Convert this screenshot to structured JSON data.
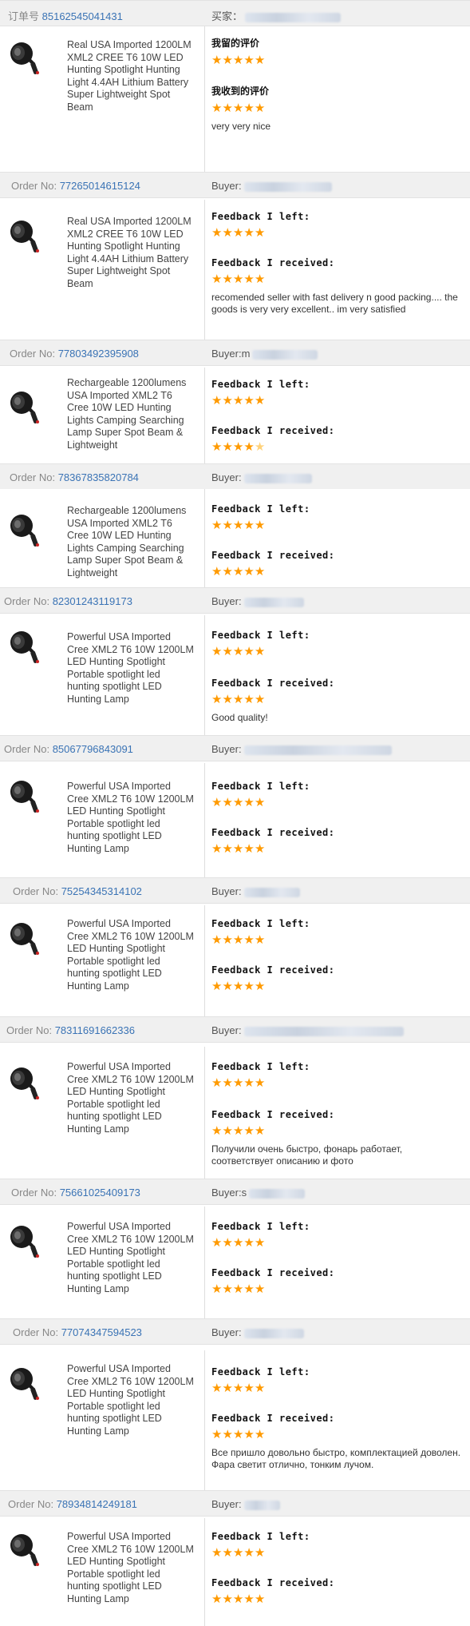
{
  "labels": {
    "order_cn": "订单号",
    "buyer_cn": "买家：",
    "order_en": "Order No:",
    "buyer_en": "Buyer:",
    "left_cn": "我留的评价",
    "received_cn": "我收到的评价",
    "left_en": "Feedback I left:",
    "received_en": "Feedback I received:"
  },
  "colors": {
    "star": "#ff9a00",
    "order_number": "#3a73b5",
    "header_bg": "#f0f0f0"
  },
  "icons": [
    "flashlight-thumbnail-icon",
    "star-icon"
  ],
  "orders": [
    {
      "order_no": "85162545041431",
      "buyer_prefix": "",
      "title": "Real USA Imported 1200LM XML2 CREE T6 10W LED Hunting Spotlight Hunting Light 4.4AH Lithium Battery Super Lightweight Spot Beam",
      "left_stars": 5,
      "received_stars": 5,
      "comment": "very very nice"
    },
    {
      "order_no": "77265014615124",
      "buyer_prefix": "",
      "title": "Real USA Imported 1200LM XML2 CREE T6 10W LED Hunting Spotlight Hunting Light 4.4AH Lithium Battery Super Lightweight Spot Beam",
      "left_stars": 5,
      "received_stars": 5,
      "comment": "recomended seller with fast delivery n good packing.... the goods is very very excellent.. im very satisfied"
    },
    {
      "order_no": "77803492395908",
      "buyer_prefix": "m",
      "title": "Rechargeable 1200lumens USA Imported XML2 T6 Cree 10W LED Hunting Lights Camping Searching Lamp Super Spot Beam & Lightweight",
      "left_stars": 5,
      "received_stars": 4.5,
      "comment": ""
    },
    {
      "order_no": "78367835820784",
      "buyer_prefix": "",
      "title": "Rechargeable 1200lumens USA Imported XML2 T6 Cree 10W LED Hunting Lights Camping Searching Lamp Super Spot Beam & Lightweight",
      "left_stars": 5,
      "received_stars": 5,
      "comment": ""
    },
    {
      "order_no": "82301243119173",
      "buyer_prefix": "",
      "title": "Powerful USA Imported Cree XML2 T6 10W 1200LM LED Hunting Spotlight Portable spotlight led hunting spotlight LED Hunting Lamp",
      "left_stars": 5,
      "received_stars": 5,
      "comment": "Good quality!"
    },
    {
      "order_no": "85067796843091",
      "buyer_prefix": "",
      "title": "Powerful USA Imported Cree XML2 T6 10W 1200LM LED Hunting Spotlight Portable spotlight led hunting spotlight LED Hunting Lamp",
      "left_stars": 5,
      "received_stars": 5,
      "comment": ""
    },
    {
      "order_no": "75254345314102",
      "buyer_prefix": "",
      "title": "Powerful USA Imported Cree XML2 T6 10W 1200LM LED Hunting Spotlight Portable spotlight led hunting spotlight LED Hunting Lamp",
      "left_stars": 5,
      "received_stars": 5,
      "comment": ""
    },
    {
      "order_no": "78311691662336",
      "buyer_prefix": "",
      "title": "Powerful USA Imported Cree XML2 T6 10W 1200LM LED Hunting Spotlight Portable spotlight led hunting spotlight LED Hunting Lamp",
      "left_stars": 5,
      "received_stars": 5,
      "comment": "Получили очень быстро, фонарь работает, соответствует описанию и фото"
    },
    {
      "order_no": "75661025409173",
      "buyer_prefix": "s",
      "title": "Powerful USA Imported Cree XML2 T6 10W 1200LM LED Hunting Spotlight Portable spotlight led hunting spotlight LED Hunting Lamp",
      "left_stars": 5,
      "received_stars": 5,
      "comment": ""
    },
    {
      "order_no": "77074347594523",
      "buyer_prefix": "",
      "title": "Powerful USA Imported Cree XML2 T6 10W 1200LM LED Hunting Spotlight Portable spotlight led hunting spotlight LED Hunting Lamp",
      "left_stars": 5,
      "received_stars": 5,
      "comment": "Все пришло довольно быстро, комплектацией доволен. Фара светит отлично, тонким лучом."
    },
    {
      "order_no": "78934814249181",
      "buyer_prefix": "",
      "title": "Powerful USA Imported Cree XML2 T6 10W 1200LM LED Hunting Spotlight Portable spotlight led hunting spotlight LED Hunting Lamp",
      "left_stars": 5,
      "received_stars": 5,
      "comment": ""
    }
  ]
}
